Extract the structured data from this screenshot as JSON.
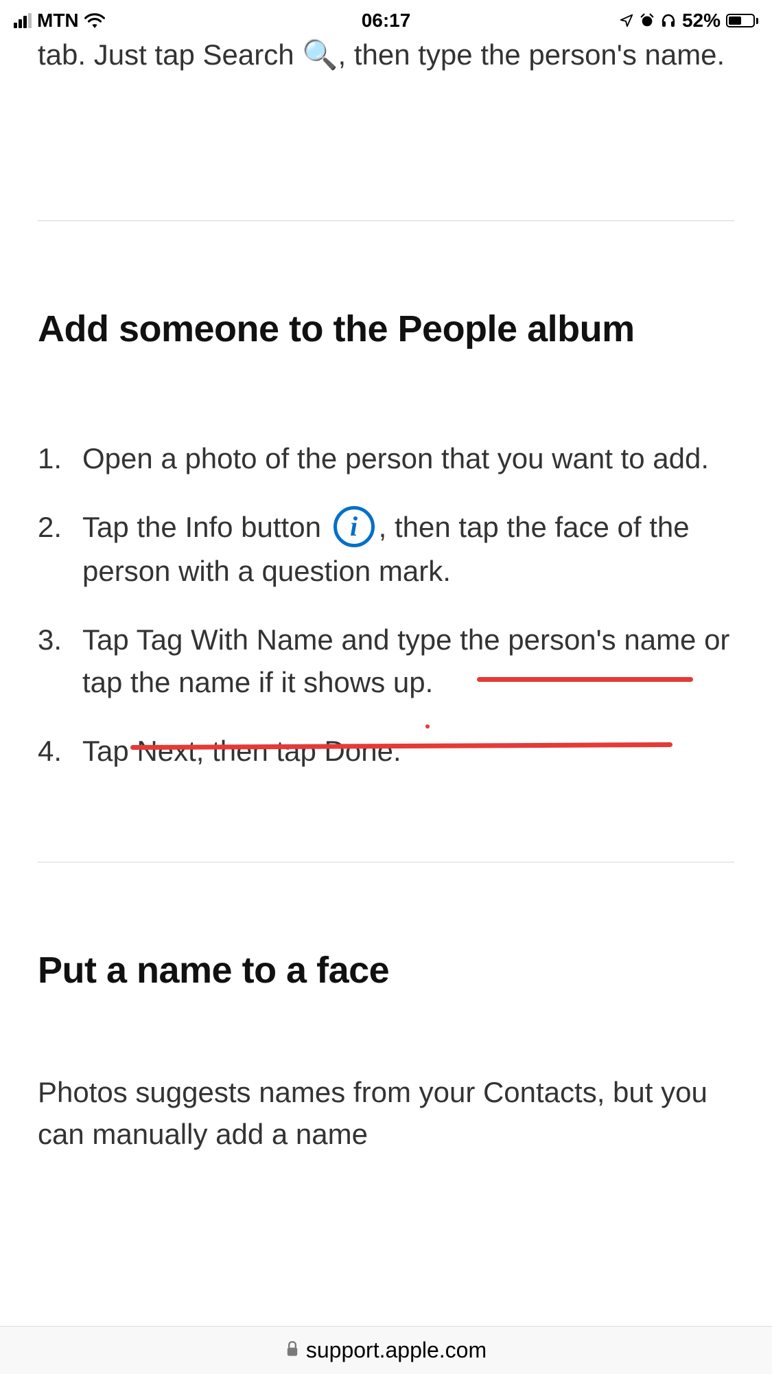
{
  "status_bar": {
    "carrier": "MTN",
    "time": "06:17",
    "battery_percent": "52%"
  },
  "content": {
    "partial_top": "tab. Just tap Search 🔍, then type the person's name.",
    "section1_heading": "Add someone to the People album",
    "steps": [
      {
        "num": "1.",
        "text_full": "Open a photo of the person that you want to add."
      },
      {
        "num": "2.",
        "text_before": "Tap the Info button ",
        "text_after": ", then tap the face of the person with a question mark."
      },
      {
        "num": "3.",
        "text_full": "Tap Tag With Name and type the person's name or tap the name if it shows up."
      },
      {
        "num": "4.",
        "text_full": "Tap Next, then tap Done."
      }
    ],
    "section2_heading": "Put a name to a face",
    "body_text": "Photos suggests names from your Contacts, but you can manually add a name"
  },
  "url_bar": {
    "domain": "support.apple.com"
  }
}
